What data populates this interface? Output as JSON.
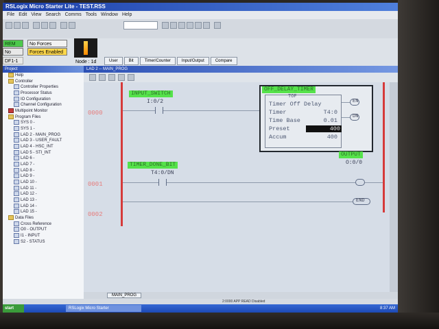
{
  "window": {
    "title": "RSLogix Micro Starter Lite - TEST.RSS"
  },
  "menu": [
    "File",
    "Edit",
    "View",
    "Search",
    "Comms",
    "Tools",
    "Window",
    "Help"
  ],
  "status": {
    "mode": "REM RUN",
    "forces": "No Forces",
    "forces_enabled": "Forces Enabled",
    "edits": "No Edits",
    "node": "Node : 1d",
    "driver": "DF1-1"
  },
  "instruction_tabs": [
    "User",
    "Bit",
    "Timer/Counter",
    "Input/Output",
    "Compare"
  ],
  "project": {
    "header": "Project",
    "items": [
      {
        "label": "Help",
        "indent": 1,
        "icon": "folder"
      },
      {
        "label": "Controller",
        "indent": 1,
        "icon": "folder"
      },
      {
        "label": "Controller Properties",
        "indent": 2,
        "icon": "doc"
      },
      {
        "label": "Processor Status",
        "indent": 2,
        "icon": "doc"
      },
      {
        "label": "IO Configuration",
        "indent": 2,
        "icon": "doc"
      },
      {
        "label": "Channel Configuration",
        "indent": 2,
        "icon": "doc"
      },
      {
        "label": "Multipoint Monitor",
        "indent": 1,
        "icon": "red"
      },
      {
        "label": "Program Files",
        "indent": 1,
        "icon": "folder"
      },
      {
        "label": "SYS 0 -",
        "indent": 2,
        "icon": "doc"
      },
      {
        "label": "SYS 1 -",
        "indent": 2,
        "icon": "doc"
      },
      {
        "label": "LAD 2 - MAIN_PROG",
        "indent": 2,
        "icon": "doc"
      },
      {
        "label": "LAD 3 - USER_FAULT",
        "indent": 2,
        "icon": "doc"
      },
      {
        "label": "LAD 4 - HSC_INT",
        "indent": 2,
        "icon": "doc"
      },
      {
        "label": "LAD 5 - STI_INT",
        "indent": 2,
        "icon": "doc"
      },
      {
        "label": "LAD 6 -",
        "indent": 2,
        "icon": "doc"
      },
      {
        "label": "LAD 7 -",
        "indent": 2,
        "icon": "doc"
      },
      {
        "label": "LAD 8 -",
        "indent": 2,
        "icon": "doc"
      },
      {
        "label": "LAD 9 -",
        "indent": 2,
        "icon": "doc"
      },
      {
        "label": "LAD 10 -",
        "indent": 2,
        "icon": "doc"
      },
      {
        "label": "LAD 11 -",
        "indent": 2,
        "icon": "doc"
      },
      {
        "label": "LAD 12 -",
        "indent": 2,
        "icon": "doc"
      },
      {
        "label": "LAD 13 -",
        "indent": 2,
        "icon": "doc"
      },
      {
        "label": "LAD 14 -",
        "indent": 2,
        "icon": "doc"
      },
      {
        "label": "LAD 15 -",
        "indent": 2,
        "icon": "doc"
      },
      {
        "label": "Data Files",
        "indent": 1,
        "icon": "folder"
      },
      {
        "label": "Cross Reference",
        "indent": 2,
        "icon": "doc"
      },
      {
        "label": "O0 - OUTPUT",
        "indent": 2,
        "icon": "doc"
      },
      {
        "label": "I1 - INPUT",
        "indent": 2,
        "icon": "doc"
      },
      {
        "label": "S2 - STATUS",
        "indent": 2,
        "icon": "doc"
      }
    ]
  },
  "editor": {
    "title": "LAD 2 -- MAIN_PROG",
    "tab": "MAIN_PROG",
    "rungs": {
      "r0": "0000",
      "r1": "0001",
      "r2": "0002"
    },
    "input_switch": {
      "tag": "INPUT_SWITCH",
      "address": "I:0/2"
    },
    "timer_done": {
      "tag": "TIMER_DONE_BIT",
      "address": "T4:0/DN"
    },
    "output": {
      "tag": "OUTPUT",
      "address": "O:0/0"
    },
    "end_coil": "END",
    "tof": {
      "tag": "OFF_DELAY_TIMER",
      "type": "TOF",
      "description": "Timer Off Delay",
      "timer_label": "Timer",
      "timer": "T4:0",
      "timebase_label": "Time Base",
      "timebase": "0.01",
      "preset_label": "Preset",
      "preset": "400",
      "accum_label": "Accum",
      "accum": "400",
      "en": "EN",
      "dn": "DN"
    }
  },
  "statusbar": {
    "text": "2:0000  APP  READ  Disabled"
  },
  "taskbar": {
    "start": "start",
    "task": "RSLogix Micro Starter",
    "clock": "8:37 AM"
  }
}
